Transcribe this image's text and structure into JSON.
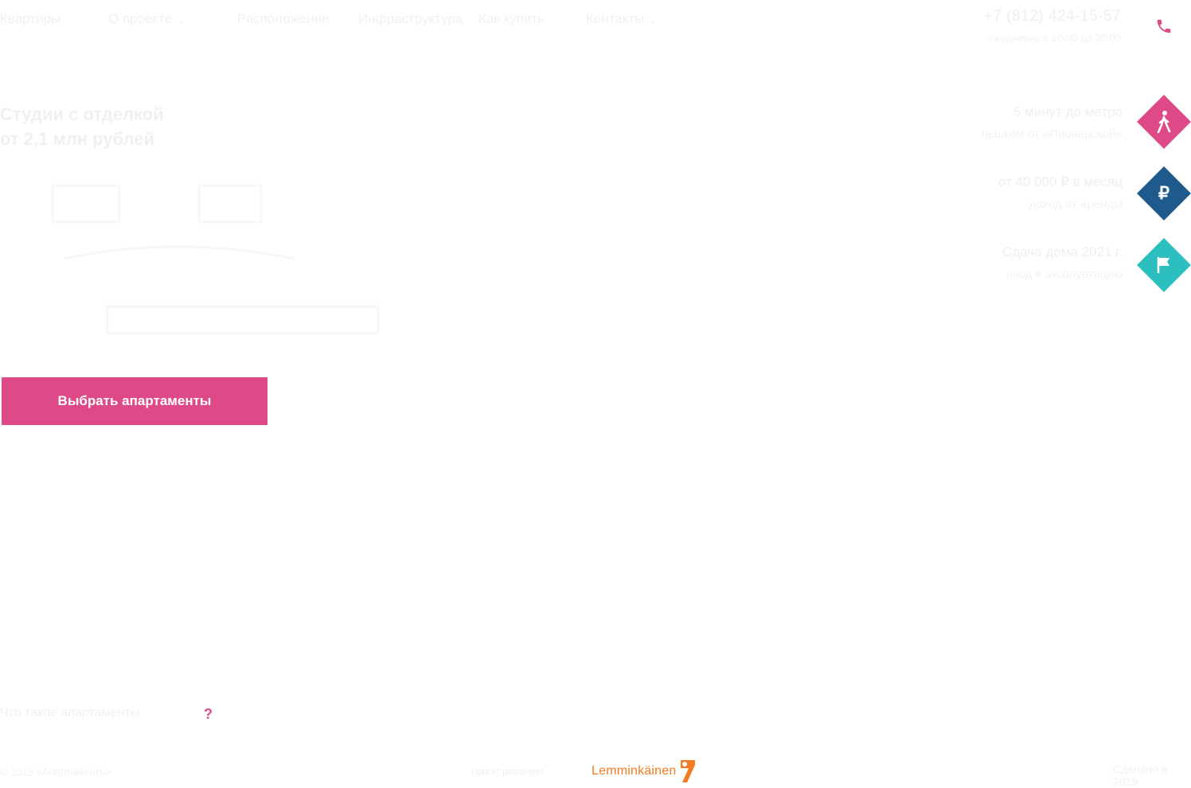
{
  "nav": {
    "items": [
      {
        "label": "Квартиры"
      },
      {
        "label": "О проекте"
      },
      {
        "label": "Расположение"
      },
      {
        "label": "Инфраструктура"
      },
      {
        "label": "Как купить"
      },
      {
        "label": "Контакты"
      }
    ]
  },
  "contact": {
    "phone": "+7 (812) 424-15-57",
    "hours": "ежедневно с 10:00 до 20:00"
  },
  "hero": {
    "title_line1": "Студии с отделкой",
    "title_line2": "от 2,1 млн рублей"
  },
  "cta": {
    "label": "Выбрать апартаменты"
  },
  "features": [
    {
      "line1": "5 минут до метро",
      "line2": "пешком от «Пионерской»",
      "icon": "walking-person-icon",
      "color": "#de4a87"
    },
    {
      "line1": "от 40 000 ₽ в месяц",
      "line2": "доход от аренды",
      "icon": "ruble-icon",
      "color": "#1f5a8c"
    },
    {
      "line1": "Сдача дома 2021 г.",
      "line2": "ввод в эксплуатацию",
      "icon": "flag-icon",
      "color": "#2dbfbf"
    }
  ],
  "question": {
    "text": "Что такое апартаменты",
    "mark": "?"
  },
  "footer": {
    "left": "© 2019 «Апартаменты»",
    "developer_label": "Проект реализует",
    "developer_name": "Lemminkäinen",
    "right": "Сделано в 2019"
  },
  "colors": {
    "accent_pink": "#de4a87",
    "brand_orange": "#f47b20"
  }
}
